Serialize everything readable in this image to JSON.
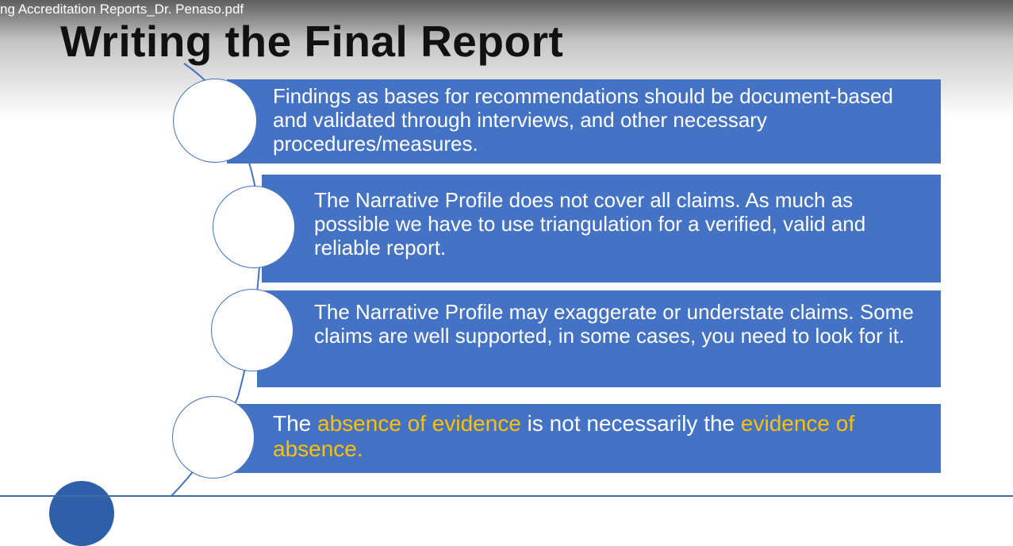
{
  "window": {
    "file_title": "ng Accreditation Reports_Dr. Penaso.pdf"
  },
  "slide": {
    "title": "Writing the Final Report",
    "items": [
      {
        "text": "Findings as bases for recommendations should be document-based and validated through interviews, and other necessary procedures/measures."
      },
      {
        "text": "The Narrative Profile does not cover all claims. As much as possible we have to use triangulation for a verified, valid and reliable report."
      },
      {
        "text": "The Narrative Profile may exaggerate or understate claims. Some claims are well supported, in some cases, you need to look for it."
      },
      {
        "parts": [
          "The ",
          "absence of evidence",
          " is not necessarily the ",
          "evidence of absence."
        ]
      }
    ]
  },
  "colors": {
    "bar": "#4472C4",
    "highlight": "#FFC000",
    "text": "#FFFFFF"
  }
}
